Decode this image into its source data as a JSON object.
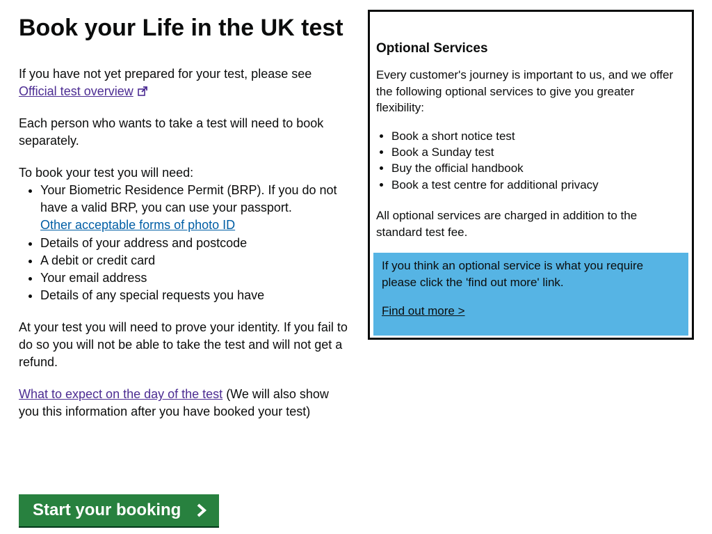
{
  "main": {
    "title": "Book your Life in the UK test",
    "prep_text": "If you have not yet prepared for your test, please see",
    "overview_link": "Official test overview",
    "separate_text": "Each person who wants to take a test will need to book separately.",
    "need_heading": "To book your test you will need:",
    "brp_text": "Your Biometric Residence Permit (BRP). If you do not have a valid BRP, you can use your passport.",
    "photo_id_link": "Other acceptable forms of photo ID",
    "requirements": [
      "Details of your address and postcode",
      "A debit or credit card",
      "Your email address",
      "Details of any special requests you have"
    ],
    "identity_text": "At your test you will need to prove your identity. If you fail to do so you will not be able to take the test and will not get a refund.",
    "expect_link": "What to expect on the day of the test",
    "expect_suffix": " (We will also show you this information after you have booked your test)",
    "start_button": "Start your booking"
  },
  "sidebar": {
    "heading": "Optional Services",
    "intro": "Every customer's journey is important to us, and we offer the following optional services to give you greater flexibility:",
    "services": [
      "Book a short notice test",
      "Book a Sunday test",
      "Buy the official handbook",
      "Book a test centre for additional privacy"
    ],
    "charge_note": "All optional services are charged in addition to the standard test fee.",
    "callout_text": "If you think an optional service is what you require please click the 'find out more' link.",
    "find_out_more": "Find out more >"
  },
  "colors": {
    "button": "#28813f",
    "callout": "#56b4e4",
    "link_visited": "#4c2c92",
    "link": "#005ea5"
  },
  "icons": [
    "external-link-icon",
    "chevron-right-icon"
  ]
}
